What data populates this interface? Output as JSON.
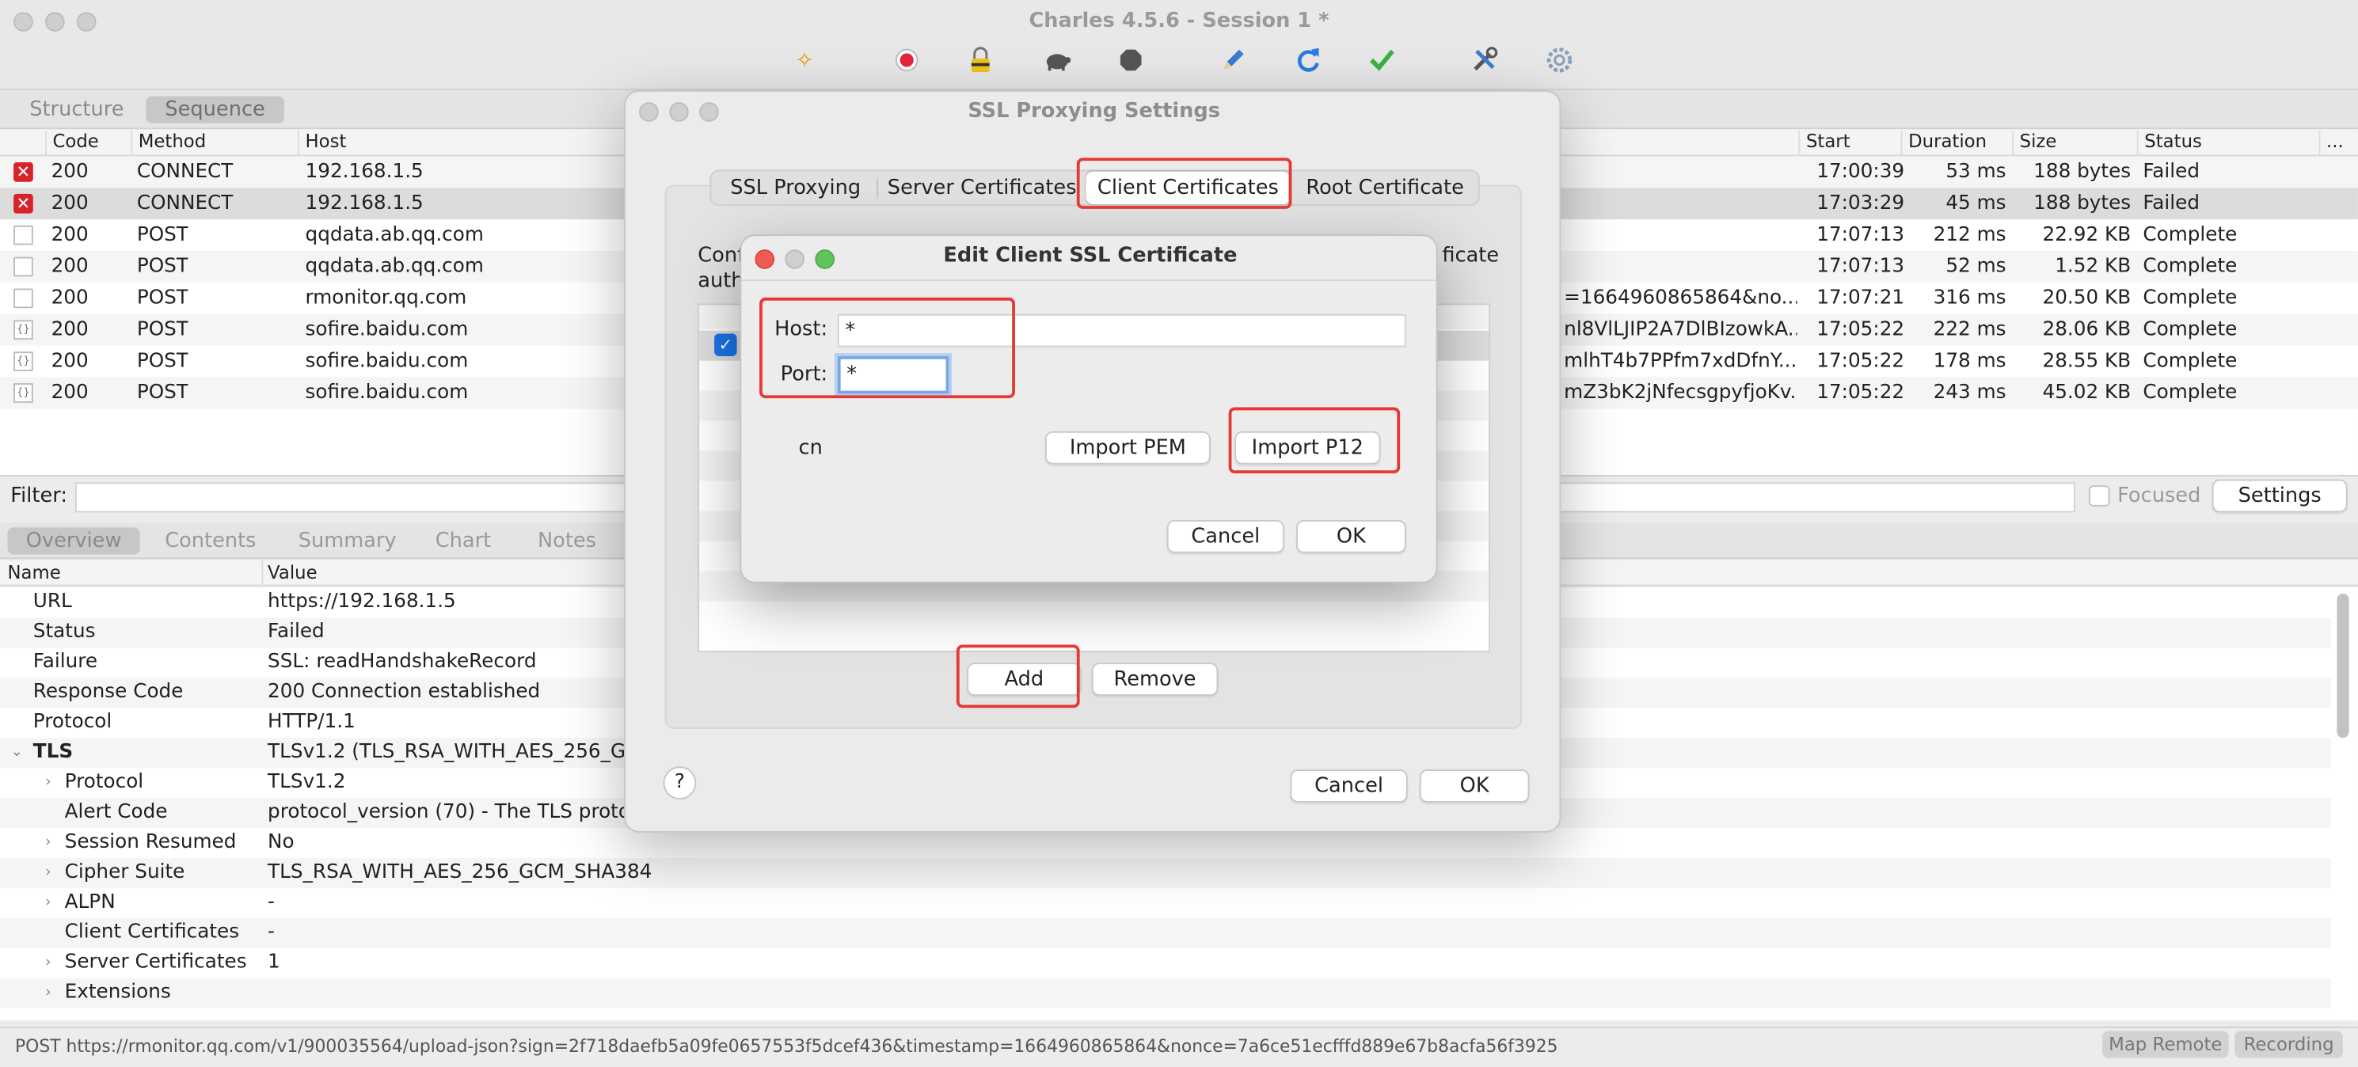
{
  "window": {
    "title": "Charles 4.5.6 - Session 1 *"
  },
  "toolbar": {
    "icons": [
      "broom-icon",
      "record-icon",
      "lock-icon",
      "turtle-icon",
      "stop-icon",
      "pen-icon",
      "refresh-icon",
      "check-icon",
      "tools-icon",
      "gear-icon"
    ]
  },
  "view_tabs": {
    "structure": "Structure",
    "sequence": "Sequence"
  },
  "table": {
    "headers": {
      "code": "Code",
      "method": "Method",
      "host": "Host",
      "start": "Start",
      "duration": "Duration",
      "size": "Size",
      "status": "Status",
      "more": "..."
    },
    "rows": [
      {
        "code": "200",
        "method": "CONNECT",
        "host": "192.168.1.5",
        "path": "",
        "start": "17:00:39",
        "duration": "53 ms",
        "size": "188 bytes",
        "status": "Failed"
      },
      {
        "code": "200",
        "method": "CONNECT",
        "host": "192.168.1.5",
        "path": "",
        "start": "17:03:29",
        "duration": "45 ms",
        "size": "188 bytes",
        "status": "Failed"
      },
      {
        "code": "200",
        "method": "POST",
        "host": "qqdata.ab.qq.com",
        "path": "",
        "start": "17:07:13",
        "duration": "212 ms",
        "size": "22.92 KB",
        "status": "Complete"
      },
      {
        "code": "200",
        "method": "POST",
        "host": "qqdata.ab.qq.com",
        "path": "",
        "start": "17:07:13",
        "duration": "52 ms",
        "size": "1.52 KB",
        "status": "Complete"
      },
      {
        "code": "200",
        "method": "POST",
        "host": "rmonitor.qq.com",
        "path": "=1664960865864&no...",
        "start": "17:07:21",
        "duration": "316 ms",
        "size": "20.50 KB",
        "status": "Complete"
      },
      {
        "code": "200",
        "method": "POST",
        "host": "sofire.baidu.com",
        "path": "nl8VlLJIP2A7DlBIzowkA...",
        "start": "17:05:22",
        "duration": "222 ms",
        "size": "28.06 KB",
        "status": "Complete"
      },
      {
        "code": "200",
        "method": "POST",
        "host": "sofire.baidu.com",
        "path": "mlhT4b7PPfm7xdDfnY...",
        "start": "17:05:22",
        "duration": "178 ms",
        "size": "28.55 KB",
        "status": "Complete"
      },
      {
        "code": "200",
        "method": "POST",
        "host": "sofire.baidu.com",
        "path": "mZ3bK2jNfecsgpyfjoKv...",
        "start": "17:05:22",
        "duration": "243 ms",
        "size": "45.02 KB",
        "status": "Complete"
      }
    ]
  },
  "filter": {
    "label": "Filter:",
    "focused_label": "Focused",
    "settings_label": "Settings"
  },
  "detail_tabs": {
    "overview": "Overview",
    "contents": "Contents",
    "summary": "Summary",
    "chart": "Chart",
    "notes": "Notes"
  },
  "detail": {
    "headers": {
      "name": "Name",
      "value": "Value"
    },
    "rows": [
      {
        "name": "URL",
        "value": "https://192.168.1.5"
      },
      {
        "name": "Status",
        "value": "Failed"
      },
      {
        "name": "Failure",
        "value": "SSL: readHandshakeRecord"
      },
      {
        "name": "Response Code",
        "value": "200 Connection established"
      },
      {
        "name": "Protocol",
        "value": "HTTP/1.1"
      },
      {
        "name": "TLS",
        "value": "TLSv1.2 (TLS_RSA_WITH_AES_256_G"
      },
      {
        "name": "Protocol",
        "value": "TLSv1.2"
      },
      {
        "name": "Alert Code",
        "value": "protocol_version (70) - The TLS protoc"
      },
      {
        "name": "Session Resumed",
        "value": "No"
      },
      {
        "name": "Cipher Suite",
        "value": "TLS_RSA_WITH_AES_256_GCM_SHA384"
      },
      {
        "name": "ALPN",
        "value": "-"
      },
      {
        "name": "Client Certificates",
        "value": "-"
      },
      {
        "name": "Server Certificates",
        "value": "1"
      },
      {
        "name": "Extensions",
        "value": ""
      }
    ]
  },
  "statusbar": {
    "text": "POST https://rmonitor.qq.com/v1/900035564/upload-json?sign=2f718daefb5a09fe0657553f5dcef436&timestamp=1664960865864&nonce=7a6ce51ecfffd889e67b8acfa56f3925",
    "map_remote": "Map Remote",
    "recording": "Recording"
  },
  "ssl_dialog": {
    "title": "SSL Proxying Settings",
    "tabs": [
      "SSL Proxying",
      "Server Certificates",
      "Client Certificates",
      "Root Certificate"
    ],
    "description_partial_1": "Conf",
    "description_partial_2": "auth",
    "description_partial_3": "ficate",
    "add_label": "Add",
    "remove_label": "Remove",
    "help_label": "?",
    "cancel_label": "Cancel",
    "ok_label": "OK"
  },
  "edit_dialog": {
    "title": "Edit Client SSL Certificate",
    "host_label": "Host:",
    "host_value": "*",
    "port_label": "Port:",
    "port_value": "*",
    "cert_name": "cn",
    "import_pem_label": "Import PEM",
    "import_p12_label": "Import P12",
    "cancel_label": "Cancel",
    "ok_label": "OK"
  },
  "colors": {
    "error_red": "#d8232a",
    "highlight": "#e53935",
    "checkbox_blue": "#1a73e8",
    "mac_close": "#ee5b52",
    "mac_min": "#f5bd4f",
    "mac_max": "#5fc55b"
  }
}
